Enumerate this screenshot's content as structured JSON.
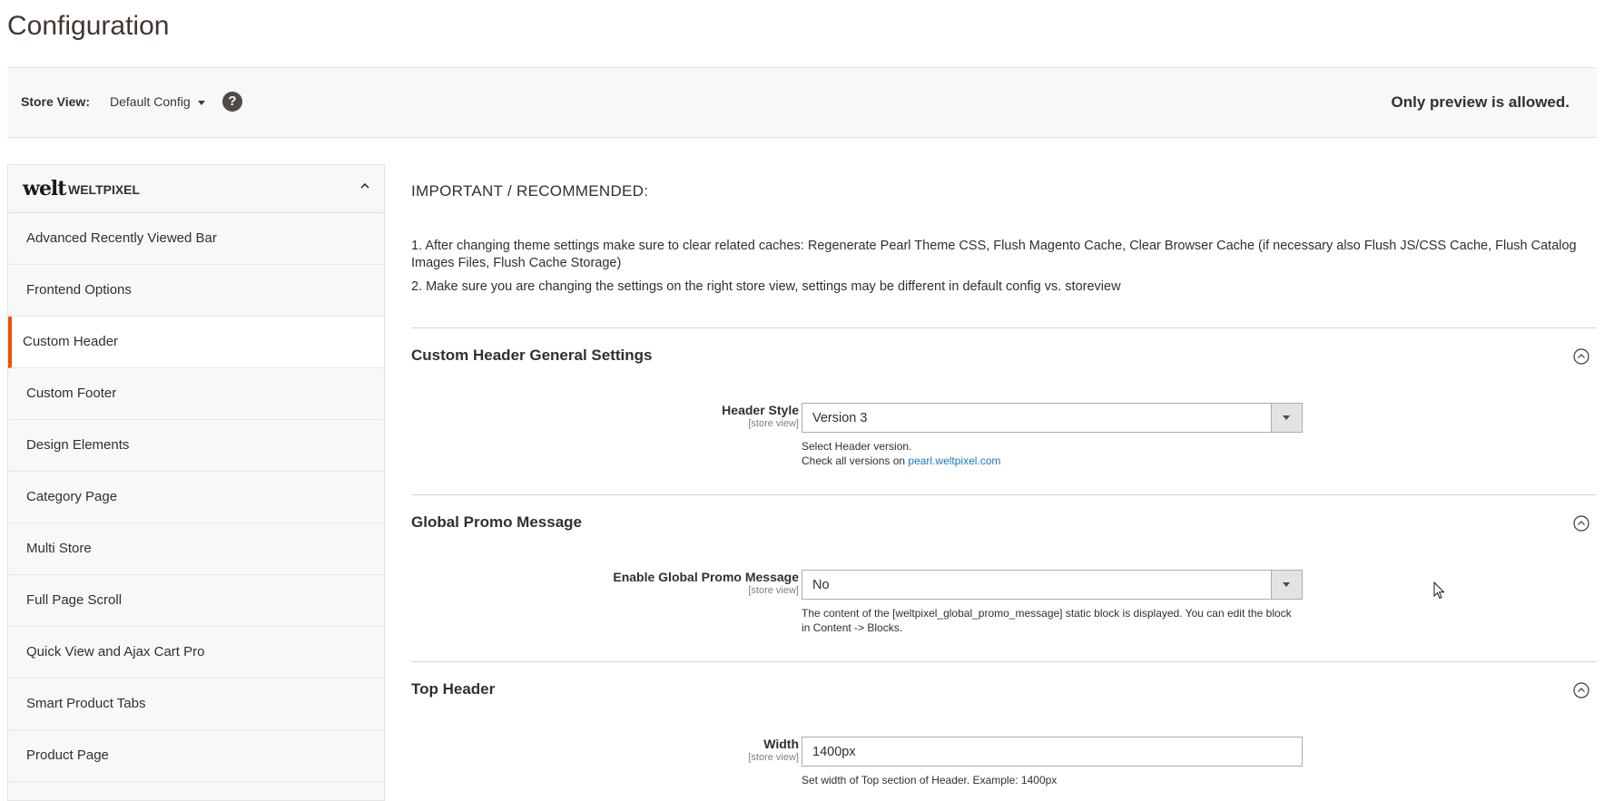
{
  "page": {
    "title": "Configuration"
  },
  "store_bar": {
    "label": "Store View:",
    "current_scope": "Default Config",
    "preview_note": "Only preview is allowed.",
    "help_glyph": "?"
  },
  "sidebar": {
    "logo_text": "welt",
    "title": "WELTPIXEL",
    "items": [
      {
        "label": "Advanced Recently Viewed Bar",
        "active": false
      },
      {
        "label": "Frontend Options",
        "active": false
      },
      {
        "label": "Custom Header",
        "active": true
      },
      {
        "label": "Custom Footer",
        "active": false
      },
      {
        "label": "Design Elements",
        "active": false
      },
      {
        "label": "Category Page",
        "active": false
      },
      {
        "label": "Multi Store",
        "active": false
      },
      {
        "label": "Full Page Scroll",
        "active": false
      },
      {
        "label": "Quick View and Ajax Cart Pro",
        "active": false
      },
      {
        "label": "Smart Product Tabs",
        "active": false
      },
      {
        "label": "Product Page",
        "active": false
      }
    ]
  },
  "main": {
    "important_title": "IMPORTANT / RECOMMENDED:",
    "notes": [
      "1. After changing theme settings make sure to clear related caches: Regenerate Pearl Theme CSS, Flush Magento Cache, Clear Browser Cache (if necessary also Flush JS/CSS Cache, Flush Catalog Images Files, Flush Cache Storage)",
      "2. Make sure you are changing the settings on the right store view, settings may be different in default config vs. storeview"
    ],
    "sections": {
      "general": {
        "title": "Custom Header General Settings",
        "field_label": "Header Style",
        "scope": "[store view]",
        "value": "Version 3",
        "note_line1": "Select Header version.",
        "note_line2_prefix": "Check all versions on ",
        "note_link": "pearl.weltpixel.com"
      },
      "promo": {
        "title": "Global Promo Message",
        "field_label": "Enable Global Promo Message",
        "scope": "[store view]",
        "value": "No",
        "note": "The content of the [weltpixel_global_promo_message] static block is displayed. You can edit the block in Content -> Blocks."
      },
      "top_header": {
        "title": "Top Header",
        "field_label": "Width",
        "scope": "[store view]",
        "value": "1400px",
        "note": "Set width of Top section of Header. Example: 1400px"
      }
    }
  },
  "colors": {
    "accent": "#eb5202",
    "link": "#1979c3"
  }
}
